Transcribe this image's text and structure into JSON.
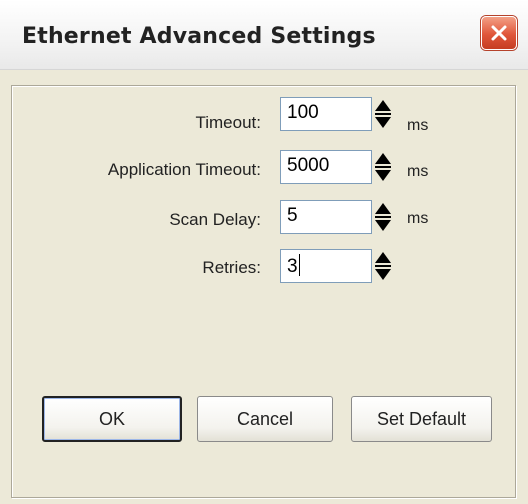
{
  "window": {
    "title": "Ethernet Advanced Settings"
  },
  "fields": {
    "timeout": {
      "label": "Timeout:",
      "value": "100",
      "unit": "ms"
    },
    "application_timeout": {
      "label": "Application Timeout:",
      "value": "5000",
      "unit": "ms"
    },
    "scan_delay": {
      "label": "Scan Delay:",
      "value": "5",
      "unit": "ms"
    },
    "retries": {
      "label": "Retries:",
      "value": "3"
    }
  },
  "buttons": {
    "ok": "OK",
    "cancel": "Cancel",
    "set_default": "Set Default"
  },
  "icons": {
    "close": "close-icon",
    "spinner": "spin-arrows-icon"
  },
  "colors": {
    "close_red": "#e0563a",
    "field_border": "#7f9db9",
    "dialog_bg": "#ece9d8"
  }
}
